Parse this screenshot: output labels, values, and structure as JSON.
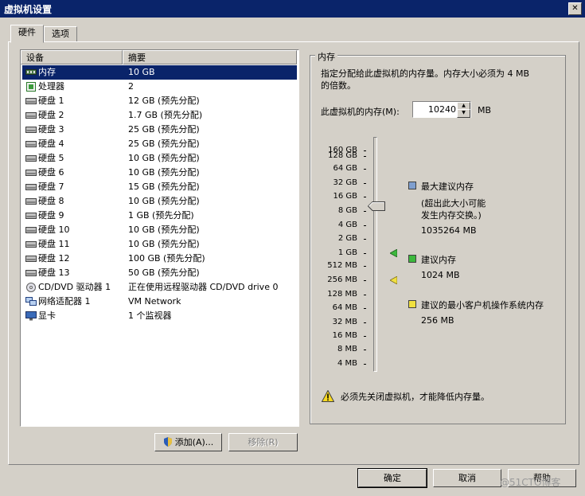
{
  "window": {
    "title": "虚拟机设置",
    "close_glyph": "✕"
  },
  "tabs": [
    {
      "label": "硬件"
    },
    {
      "label": "选项"
    }
  ],
  "device_list": {
    "columns": {
      "device": "设备",
      "summary": "摘要"
    },
    "rows": [
      {
        "name": "内存",
        "summary": "10 GB",
        "icon": "memory-icon"
      },
      {
        "name": "处理器",
        "summary": "2",
        "icon": "cpu-icon"
      },
      {
        "name": "硬盘 1",
        "summary": "12 GB (预先分配)",
        "icon": "disk-icon"
      },
      {
        "name": "硬盘 2",
        "summary": "1.7 GB (预先分配)",
        "icon": "disk-icon"
      },
      {
        "name": "硬盘 3",
        "summary": "25 GB (预先分配)",
        "icon": "disk-icon"
      },
      {
        "name": "硬盘 4",
        "summary": "25 GB (预先分配)",
        "icon": "disk-icon"
      },
      {
        "name": "硬盘 5",
        "summary": "10 GB (预先分配)",
        "icon": "disk-icon"
      },
      {
        "name": "硬盘 6",
        "summary": "10 GB (预先分配)",
        "icon": "disk-icon"
      },
      {
        "name": "硬盘 7",
        "summary": "15 GB (预先分配)",
        "icon": "disk-icon"
      },
      {
        "name": "硬盘 8",
        "summary": "10 GB (预先分配)",
        "icon": "disk-icon"
      },
      {
        "name": "硬盘 9",
        "summary": "1 GB (预先分配)",
        "icon": "disk-icon"
      },
      {
        "name": "硬盘 10",
        "summary": "10 GB (预先分配)",
        "icon": "disk-icon"
      },
      {
        "name": "硬盘 11",
        "summary": "10 GB (预先分配)",
        "icon": "disk-icon"
      },
      {
        "name": "硬盘 12",
        "summary": "100 GB (预先分配)",
        "icon": "disk-icon"
      },
      {
        "name": "硬盘 13",
        "summary": "50 GB (预先分配)",
        "icon": "disk-icon"
      },
      {
        "name": "CD/DVD 驱动器 1",
        "summary": "正在使用远程驱动器 CD/DVD drive 0",
        "icon": "cdrom-icon"
      },
      {
        "name": "网络适配器 1",
        "summary": "VM Network",
        "icon": "network-icon"
      },
      {
        "name": "显卡",
        "summary": "1 个监视器",
        "icon": "display-icon"
      }
    ],
    "selected_index": 0
  },
  "list_buttons": {
    "add": "添加(A)...",
    "remove": "移除(R)"
  },
  "memory_panel": {
    "group_title": "内存",
    "description_line1": "指定分配给此虚拟机的内存量。内存大小必须为 4 MB",
    "description_line2": "的倍数。",
    "field_label": "此虚拟机的内存(M):",
    "value": "10240",
    "unit": "MB",
    "scale_labels": [
      "160 GB",
      "128 GB",
      "64 GB",
      "32 GB",
      "16 GB",
      "8 GB",
      "4 GB",
      "2 GB",
      "1 GB",
      "512 MB",
      "256 MB",
      "128 MB",
      "64 MB",
      "32 MB",
      "16 MB",
      "8 MB",
      "4 MB"
    ],
    "legend": {
      "max": {
        "title": "最大建议内存",
        "sub1": "(超出此大小可能",
        "sub2": "发生内存交换。)",
        "value": "1035264 MB",
        "color": "#7f9fcf"
      },
      "recommended": {
        "title": "建议内存",
        "value": "1024 MB",
        "color": "#3cb83c"
      },
      "min": {
        "title": "建议的最小客户机操作系统内存",
        "value": "256 MB",
        "color": "#f0e040"
      }
    },
    "warning": "必须先关闭虚拟机，才能降低内存量。"
  },
  "footer": {
    "ok": "确定",
    "cancel": "取消",
    "help": "帮助",
    "watermark": "@51CTO博客"
  }
}
